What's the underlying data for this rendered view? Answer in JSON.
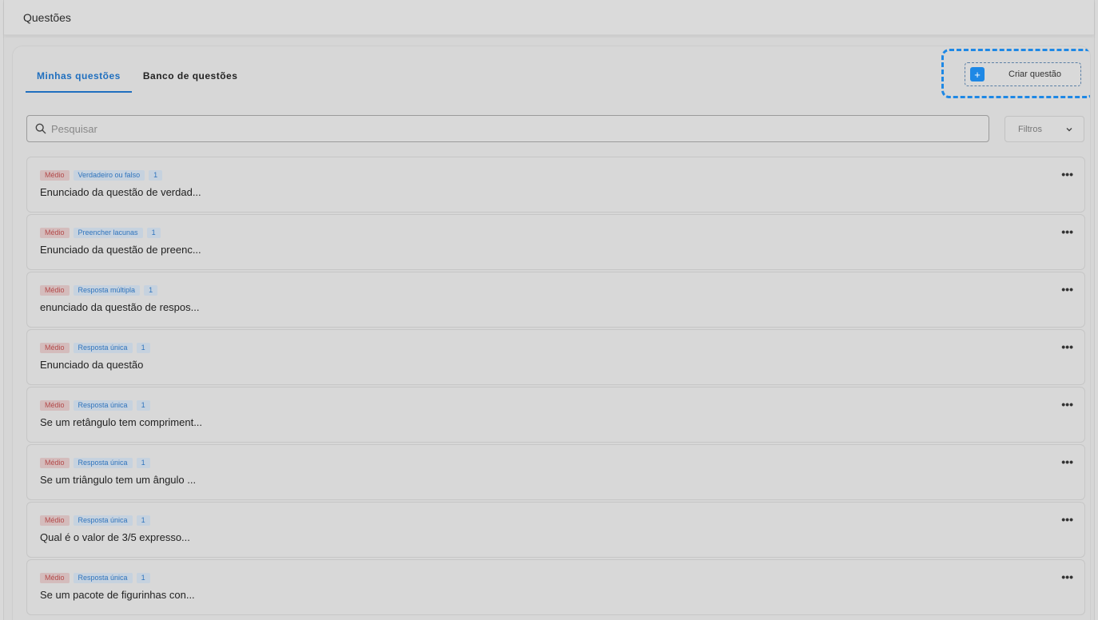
{
  "header": {
    "title": "Questões"
  },
  "tabs": [
    {
      "label": "Minhas questões",
      "active": true
    },
    {
      "label": "Banco de questões",
      "active": false
    }
  ],
  "create_button": {
    "label": "Criar questão",
    "icon": "plus-icon"
  },
  "search": {
    "placeholder": "Pesquisar",
    "value": ""
  },
  "filters": {
    "label": "Filtros",
    "icon": "chevron-down-icon"
  },
  "colors": {
    "accent": "#1e88e5",
    "tab_active": "#1f6fbf",
    "level_text": "#b34a4a",
    "tag_text": "#2f74bd"
  },
  "questions": [
    {
      "level": "Médio",
      "type": "Verdadeiro ou falso",
      "count": "1",
      "statement": "Enunciado da questão de verdad..."
    },
    {
      "level": "Médio",
      "type": "Preencher lacunas",
      "count": "1",
      "statement": "Enunciado da questão de preenc..."
    },
    {
      "level": "Médio",
      "type": "Resposta múltipla",
      "count": "1",
      "statement": "enunciado da questão de respos..."
    },
    {
      "level": "Médio",
      "type": "Resposta única",
      "count": "1",
      "statement": "Enunciado da questão"
    },
    {
      "level": "Médio",
      "type": "Resposta única",
      "count": "1",
      "statement": "Se um retângulo tem compriment..."
    },
    {
      "level": "Médio",
      "type": "Resposta única",
      "count": "1",
      "statement": "Se um triângulo tem um ângulo ..."
    },
    {
      "level": "Médio",
      "type": "Resposta única",
      "count": "1",
      "statement": "Qual é o valor de 3/5 expresso..."
    },
    {
      "level": "Médio",
      "type": "Resposta única",
      "count": "1",
      "statement": "Se um pacote de figurinhas con..."
    }
  ],
  "more_icon": "more-horizontal-icon",
  "more_glyph": "•••"
}
